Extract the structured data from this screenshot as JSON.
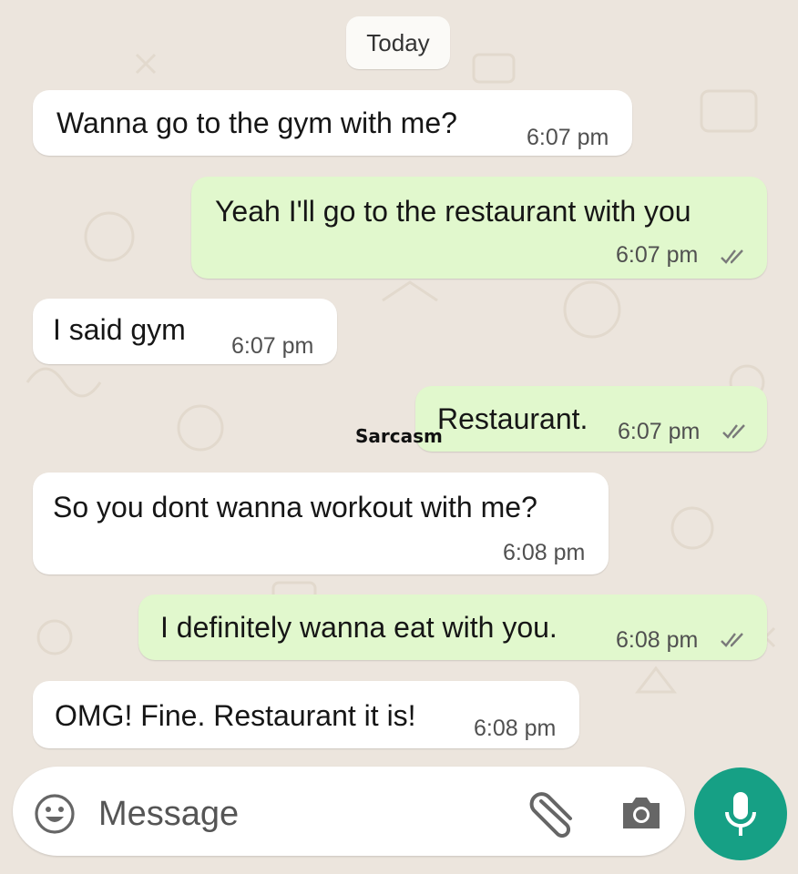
{
  "chat": {
    "date_label": "Today",
    "messages": [
      {
        "direction": "incoming",
        "text": "Wanna go to the gym with me?",
        "time": "6:07 pm"
      },
      {
        "direction": "outgoing",
        "text": "Yeah I'll go to the restaurant with you",
        "time": "6:07 pm",
        "status": "read-double-tick"
      },
      {
        "direction": "incoming",
        "text": "I said gym",
        "time": "6:07 pm"
      },
      {
        "direction": "outgoing",
        "text": "Restaurant.",
        "time": "6:07 pm",
        "status": "read-double-tick"
      },
      {
        "direction": "incoming",
        "text": "So you dont wanna workout with me?",
        "time": "6:08 pm"
      },
      {
        "direction": "outgoing",
        "text": "I definitely wanna eat with you.",
        "time": "6:08 pm",
        "status": "read-double-tick"
      },
      {
        "direction": "incoming",
        "text": "OMG! Fine. Restaurant it is!",
        "time": "6:08 pm"
      }
    ],
    "watermark": "Sarcasm"
  },
  "composer": {
    "placeholder": "Message",
    "icons": [
      "emoji-icon",
      "attach-icon",
      "camera-icon",
      "microphone-icon"
    ]
  },
  "colors": {
    "background": "#ece5dd",
    "incoming_bubble": "#ffffff",
    "outgoing_bubble": "#e1f8cd",
    "mic_button": "#16a085",
    "ticks": "#7a7a7a"
  }
}
